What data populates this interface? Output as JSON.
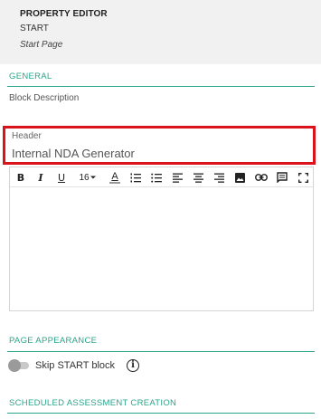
{
  "property_editor": {
    "title": "PROPERTY EDITOR",
    "block_name": "START",
    "page_name": "Start Page"
  },
  "sections": {
    "general": "GENERAL",
    "page_appearance": "PAGE APPEARANCE",
    "scheduled": "SCHEDULED ASSESSMENT CREATION"
  },
  "general": {
    "block_description_label": "Block Description",
    "header_label": "Header",
    "header_value": "Internal NDA Generator"
  },
  "toolbar": {
    "bold": "B",
    "italic": "I",
    "underline": "U",
    "font_size": "16",
    "font_color": "A",
    "icons": [
      "bold-icon",
      "italic-icon",
      "underline-icon",
      "font-size-select",
      "font-color-icon",
      "ordered-list-icon",
      "unordered-list-icon",
      "align-left-icon",
      "align-center-icon",
      "align-right-icon",
      "image-icon",
      "link-icon",
      "comment-icon",
      "fullscreen-icon"
    ]
  },
  "page_appearance": {
    "skip_start_label": "Skip START block",
    "skip_start_enabled": false,
    "info_glyph": "i"
  },
  "colors": {
    "accent": "#2aa58a",
    "highlight": "#d9121b",
    "panel": "#f1f1f1"
  }
}
